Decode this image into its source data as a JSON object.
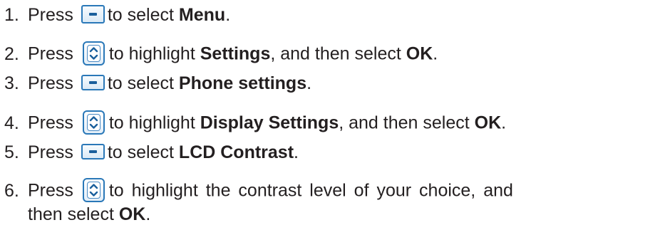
{
  "steps": [
    {
      "num": "1.",
      "pre": "Press",
      "post": "to select ",
      "bold": "Menu",
      "after": "."
    },
    {
      "num": "2.",
      "pre": "Press",
      "post": "to highlight ",
      "bold": "Settings",
      "mid": ", and then select ",
      "bold2": "OK",
      "after": "."
    },
    {
      "num": "3.",
      "pre": "Press",
      "post": "to select ",
      "bold": "Phone settings",
      "after": "."
    },
    {
      "num": "4.",
      "pre": "Press",
      "post": "to highlight ",
      "bold": "Display Settings",
      "mid": ", and then select ",
      "bold2": "OK",
      "after": "."
    },
    {
      "num": "5.",
      "pre": "Press",
      "post": "to select ",
      "bold": "LCD Contrast",
      "after": "."
    },
    {
      "num": "6.",
      "pre": "Press",
      "post": "to highlight the contrast level of your choice, and",
      "line2_pre": "then select ",
      "bold": "OK",
      "after": "."
    }
  ],
  "icons": {
    "soft_key": "soft-key-icon",
    "nav_key": "up-down-navigation-key-icon"
  },
  "colors": {
    "text": "#231f20",
    "key_border": "#2a78b8",
    "key_symbol": "#1a5f9c"
  }
}
